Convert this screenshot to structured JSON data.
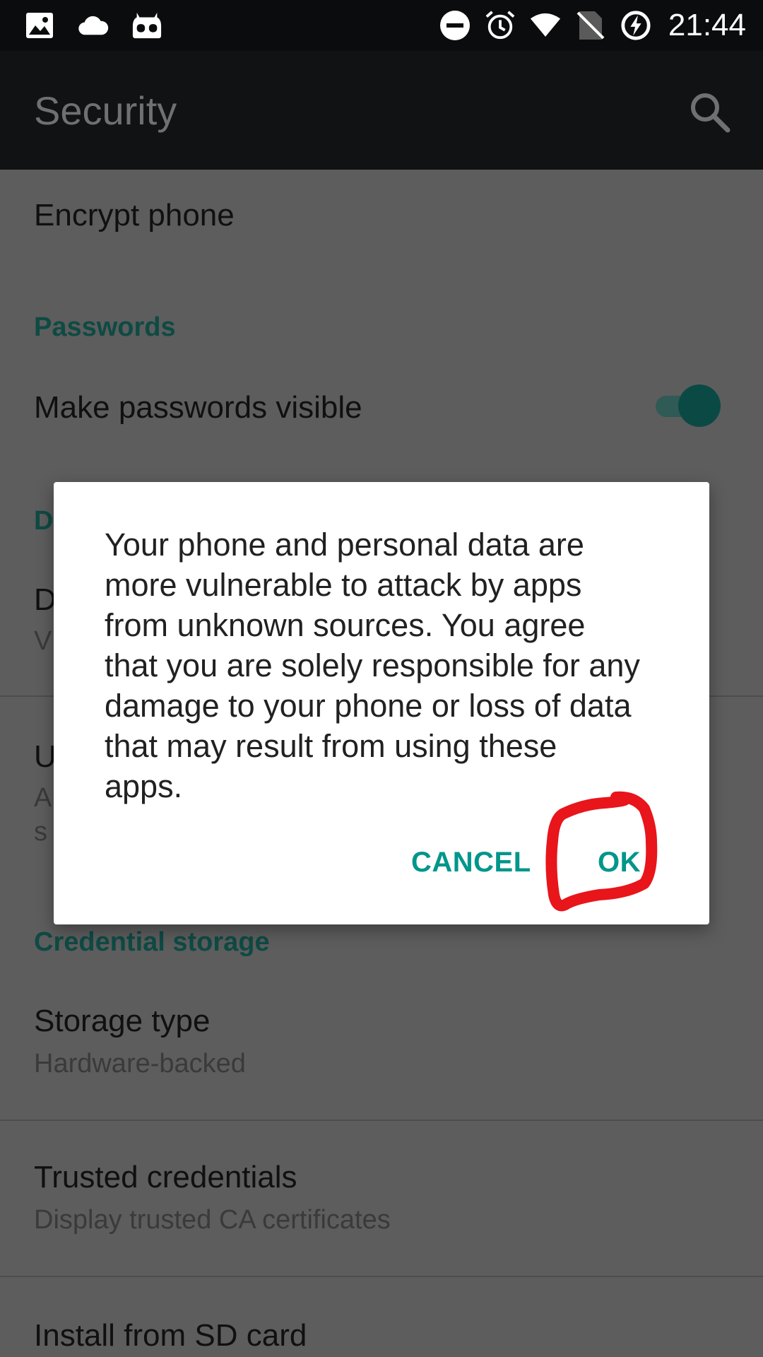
{
  "status_bar": {
    "time": "21:44",
    "left_icons": [
      "image-icon",
      "cloud-icon",
      "cyanogen-icon"
    ],
    "right_icons": [
      "do-not-disturb-icon",
      "alarm-icon",
      "wifi-icon",
      "no-sim-icon",
      "battery-charging-icon"
    ]
  },
  "app_bar": {
    "title": "Security",
    "search_icon": "search-icon"
  },
  "settings": {
    "encrypt_phone": "Encrypt phone",
    "passwords_header": "Passwords",
    "make_passwords_visible": "Make passwords visible",
    "make_passwords_visible_enabled": true,
    "hidden_section_letter": "D",
    "hidden_item_letter": "D",
    "hidden_item_sub_letter": "V",
    "unknown_sources_letter": "U",
    "unknown_sources_sub_letter_1": "A",
    "unknown_sources_sub_letter_2": "s",
    "credential_storage_header": "Credential storage",
    "storage_type": "Storage type",
    "storage_type_value": "Hardware-backed",
    "trusted_credentials": "Trusted credentials",
    "trusted_credentials_sub": "Display trusted CA certificates",
    "install_from_sd": "Install from SD card"
  },
  "dialog": {
    "message": "Your phone and personal data are more vulnerable to attack by apps from unknown sources. You agree that you are solely responsible for any damage to your phone or loss of data that may result from using these apps.",
    "cancel_label": "CANCEL",
    "ok_label": "OK"
  },
  "colors": {
    "accent": "#00968A",
    "annotation": "#E8151B",
    "scrim_background": "#5D5D5D"
  }
}
